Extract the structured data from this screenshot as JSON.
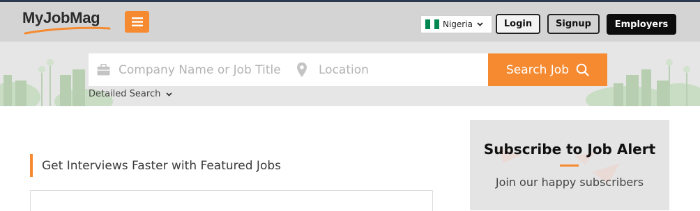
{
  "header": {
    "logo_text": "MyJobMag",
    "country": "Nigeria",
    "login_label": "Login",
    "signup_label": "Signup",
    "employers_label": "Employers"
  },
  "search": {
    "company_placeholder": "Company Name or Job Title",
    "location_placeholder": "Location",
    "button_label": "Search Job",
    "detailed_label": "Detailed Search"
  },
  "featured": {
    "heading": "Get Interviews Faster with Featured Jobs"
  },
  "subscribe": {
    "title": "Subscribe to Job Alert",
    "subtitle": "Join our happy subscribers"
  },
  "colors": {
    "accent": "#f58a31",
    "header_bg": "#d4d4d4",
    "dark": "#0d0d0d",
    "flag_green": "#008751"
  },
  "icons": [
    "hamburger-icon",
    "flag-icon",
    "chevron-down-icon",
    "briefcase-icon",
    "location-pin-icon",
    "search-icon"
  ]
}
